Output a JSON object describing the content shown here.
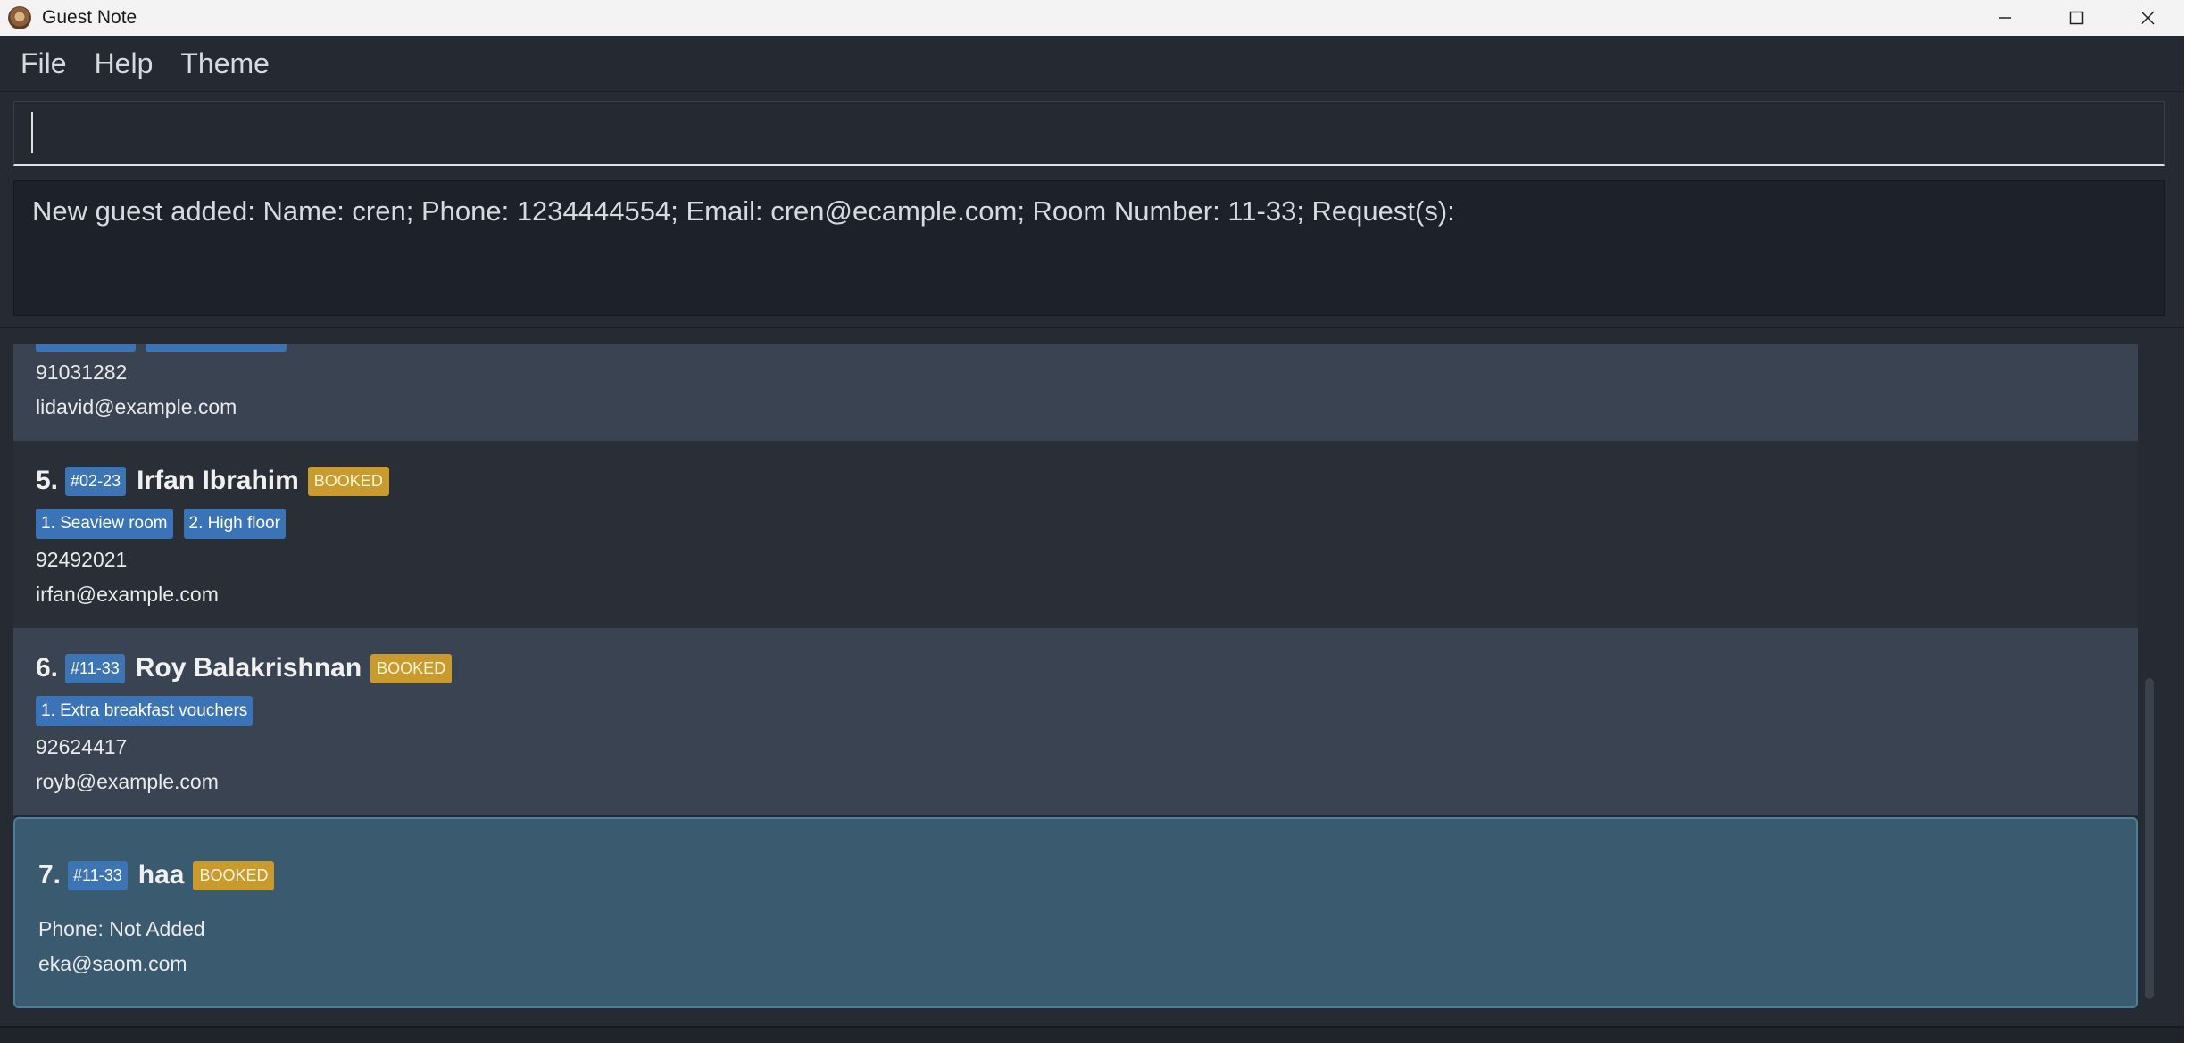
{
  "window": {
    "title": "Guest Note",
    "controls": [
      "minimize",
      "maximize",
      "close"
    ]
  },
  "menu": {
    "items": [
      "File",
      "Help",
      "Theme"
    ]
  },
  "command": {
    "value": "",
    "placeholder": ""
  },
  "result": {
    "text": "New guest added: Name: cren; Phone: 1234444554; Email: cren@ecample.com; Room Number: 11-33; Request(s):"
  },
  "guests": [
    {
      "phone": "91031282",
      "email": "lidavid@example.com"
    },
    {
      "index": "5.",
      "room": "#02-23",
      "name": "Irfan Ibrahim",
      "status": "BOOKED",
      "requests": [
        "1. Seaview room",
        "2. High floor"
      ],
      "phone": "92492021",
      "email": "irfan@example.com"
    },
    {
      "index": "6.",
      "room": "#11-33",
      "name": "Roy Balakrishnan",
      "status": "BOOKED",
      "requests": [
        "1. Extra breakfast vouchers"
      ],
      "phone": "92624417",
      "email": "royb@example.com"
    },
    {
      "index": "7.",
      "room": "#11-33",
      "name": "haa",
      "status": "BOOKED",
      "requests": [],
      "phone": "Phone: Not Added",
      "email": "eka@saom.com"
    }
  ],
  "colors": {
    "background": "#262b33",
    "room_tag": "#3d74b4",
    "status_booked": "#c99a2e",
    "selected_card": "#3a5a70"
  }
}
